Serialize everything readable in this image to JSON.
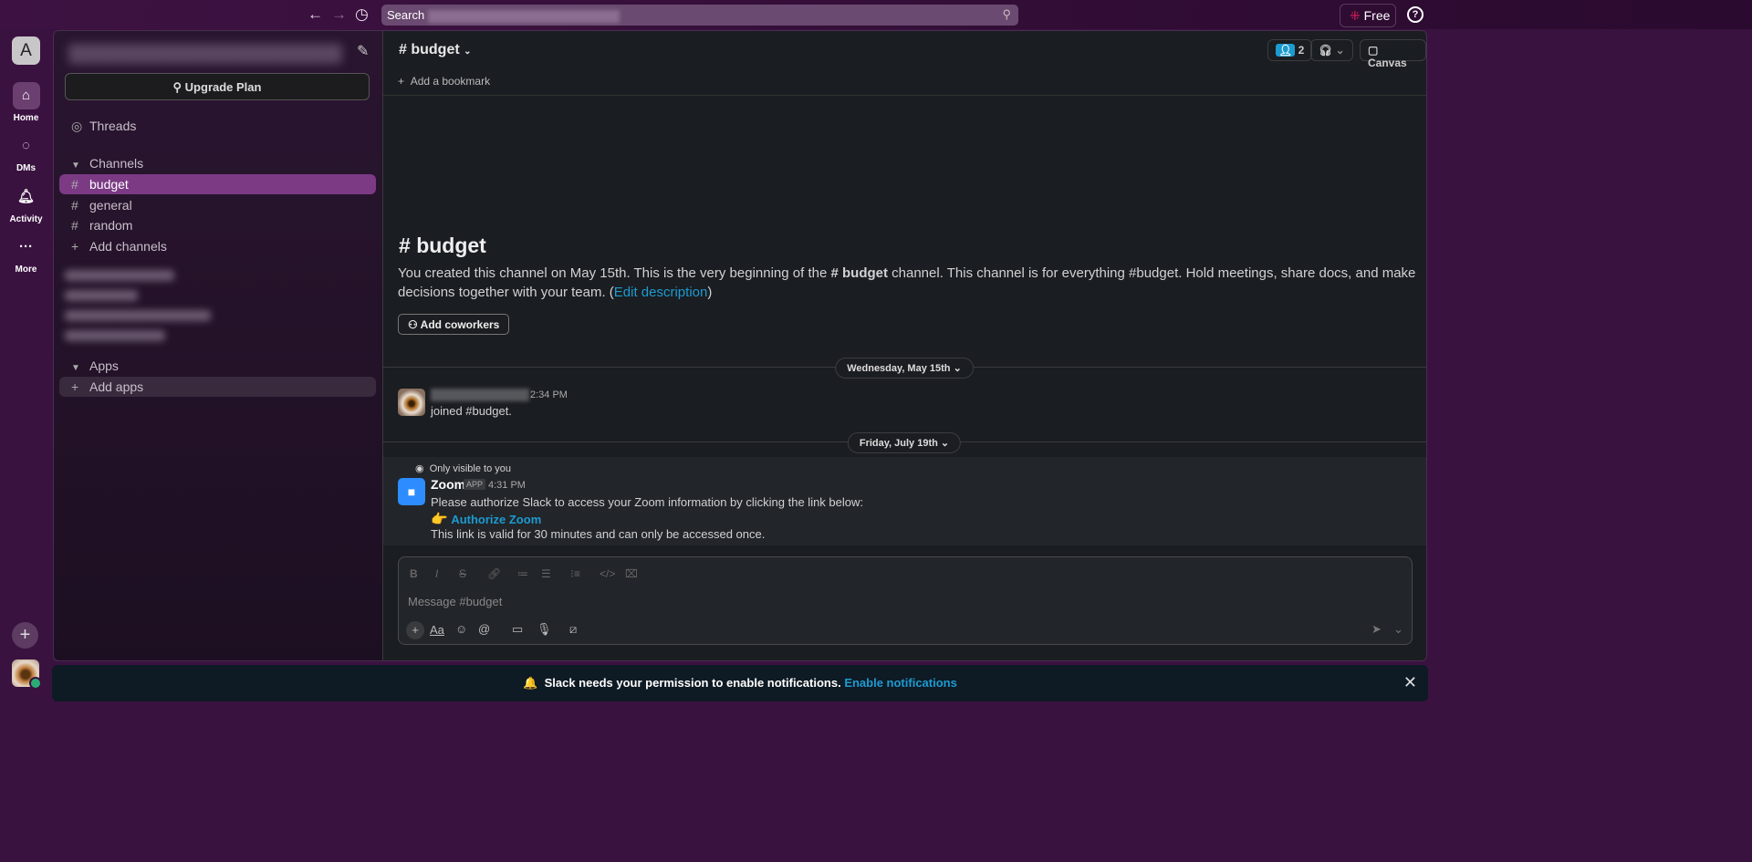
{
  "topbar": {
    "search_placeholder": "Search ",
    "free_label": "Free"
  },
  "rail": {
    "workspace_initial": "A",
    "items": [
      {
        "label": "Home",
        "icon": "home-icon"
      },
      {
        "label": "DMs",
        "icon": "dm-icon"
      },
      {
        "label": "Activity",
        "icon": "bell-icon"
      },
      {
        "label": "More",
        "icon": "more-icon"
      }
    ]
  },
  "sidebar": {
    "upgrade_label": "Upgrade Plan",
    "threads": "Threads",
    "channels_header": "Channels",
    "channels": [
      "budget",
      "general",
      "random"
    ],
    "add_channels": "Add channels",
    "apps_header": "Apps",
    "add_apps": "Add apps"
  },
  "channel": {
    "name": "budget",
    "add_bookmark": "Add a bookmark",
    "member_count": "2",
    "canvas_label": "Canvas"
  },
  "intro": {
    "title": "budget",
    "text_before": "You created this channel on May 15th. This is the very beginning of the ",
    "channel_ref": "# budget",
    "text_after": " channel. This channel is for everything #budget. Hold meetings, share docs, and make decisions together with your team. (",
    "edit_link": "Edit description",
    "text_close": ")",
    "add_coworkers": "Add coworkers"
  },
  "messages": {
    "date1": "Wednesday, May 15th",
    "m1": {
      "time": "2:34 PM",
      "text": "joined #budget."
    },
    "date2": "Friday, July 19th",
    "visibility": "Only visible to you",
    "m2": {
      "sender": "Zoom",
      "badge": "APP",
      "time": "4:31 PM",
      "line1": "Please authorize Slack to access your Zoom information by clicking the link below:",
      "link_emoji": "👉",
      "link": "Authorize Zoom",
      "line3": "This link is valid for 30 minutes and can only be accessed once."
    }
  },
  "composer": {
    "placeholder": "Message #budget"
  },
  "notification": {
    "text": "Slack needs your permission to enable notifications.",
    "link": "Enable notifications",
    "emoji": "🔔"
  },
  "colors": {
    "accent": "#7c3a85",
    "link": "#1d9bd1",
    "zoom": "#2d8cff"
  }
}
